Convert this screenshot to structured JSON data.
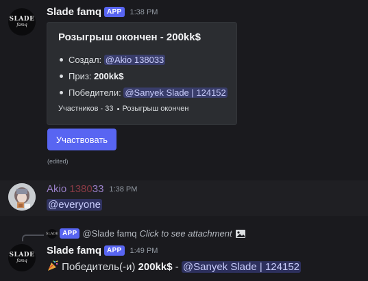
{
  "msg1": {
    "avatar_text_main": "SLADE",
    "avatar_text_sub": "famq",
    "author": "Slade famq",
    "badge": "APP",
    "time": "1:38 PM",
    "embed": {
      "title": "Розыгрыш окончен - 200kk$",
      "rows": [
        {
          "label": "Создал: ",
          "mention": "@Akio 138033"
        },
        {
          "label": "Приз: ",
          "value": "200kk$"
        },
        {
          "label": "Победители: ",
          "mention": "@Sanyek Slade | 124152"
        }
      ],
      "footer_left": "Участников - 33",
      "footer_right": "Розыгрыш окончен"
    },
    "button_label": "Участвовать",
    "edited": "(edited)"
  },
  "msg2": {
    "author": "Akio",
    "author_num_part": "1380",
    "author_num_part2": "33",
    "time": "1:38 PM",
    "content": "@everyone"
  },
  "msg3": {
    "reply_badge": "APP",
    "reply_author": "@Slade famq",
    "reply_text": "Click to see attachment",
    "mini_avatar_text": "SLADE",
    "avatar_text_main": "SLADE",
    "avatar_text_sub": "famq",
    "author": "Slade famq",
    "badge": "APP",
    "time": "1:49 PM",
    "content_prefix": "Победитель(-и) ",
    "content_bold": "200kk$",
    "content_sep": " - ",
    "content_mention": "@Sanyek Slade | 124152"
  },
  "colors": {
    "background": "#1a1a1e",
    "embed_bg": "#2b2d31",
    "brand": "#5865f2",
    "akio_name": "#9a80c9",
    "akio_num": "#8a3a45"
  }
}
